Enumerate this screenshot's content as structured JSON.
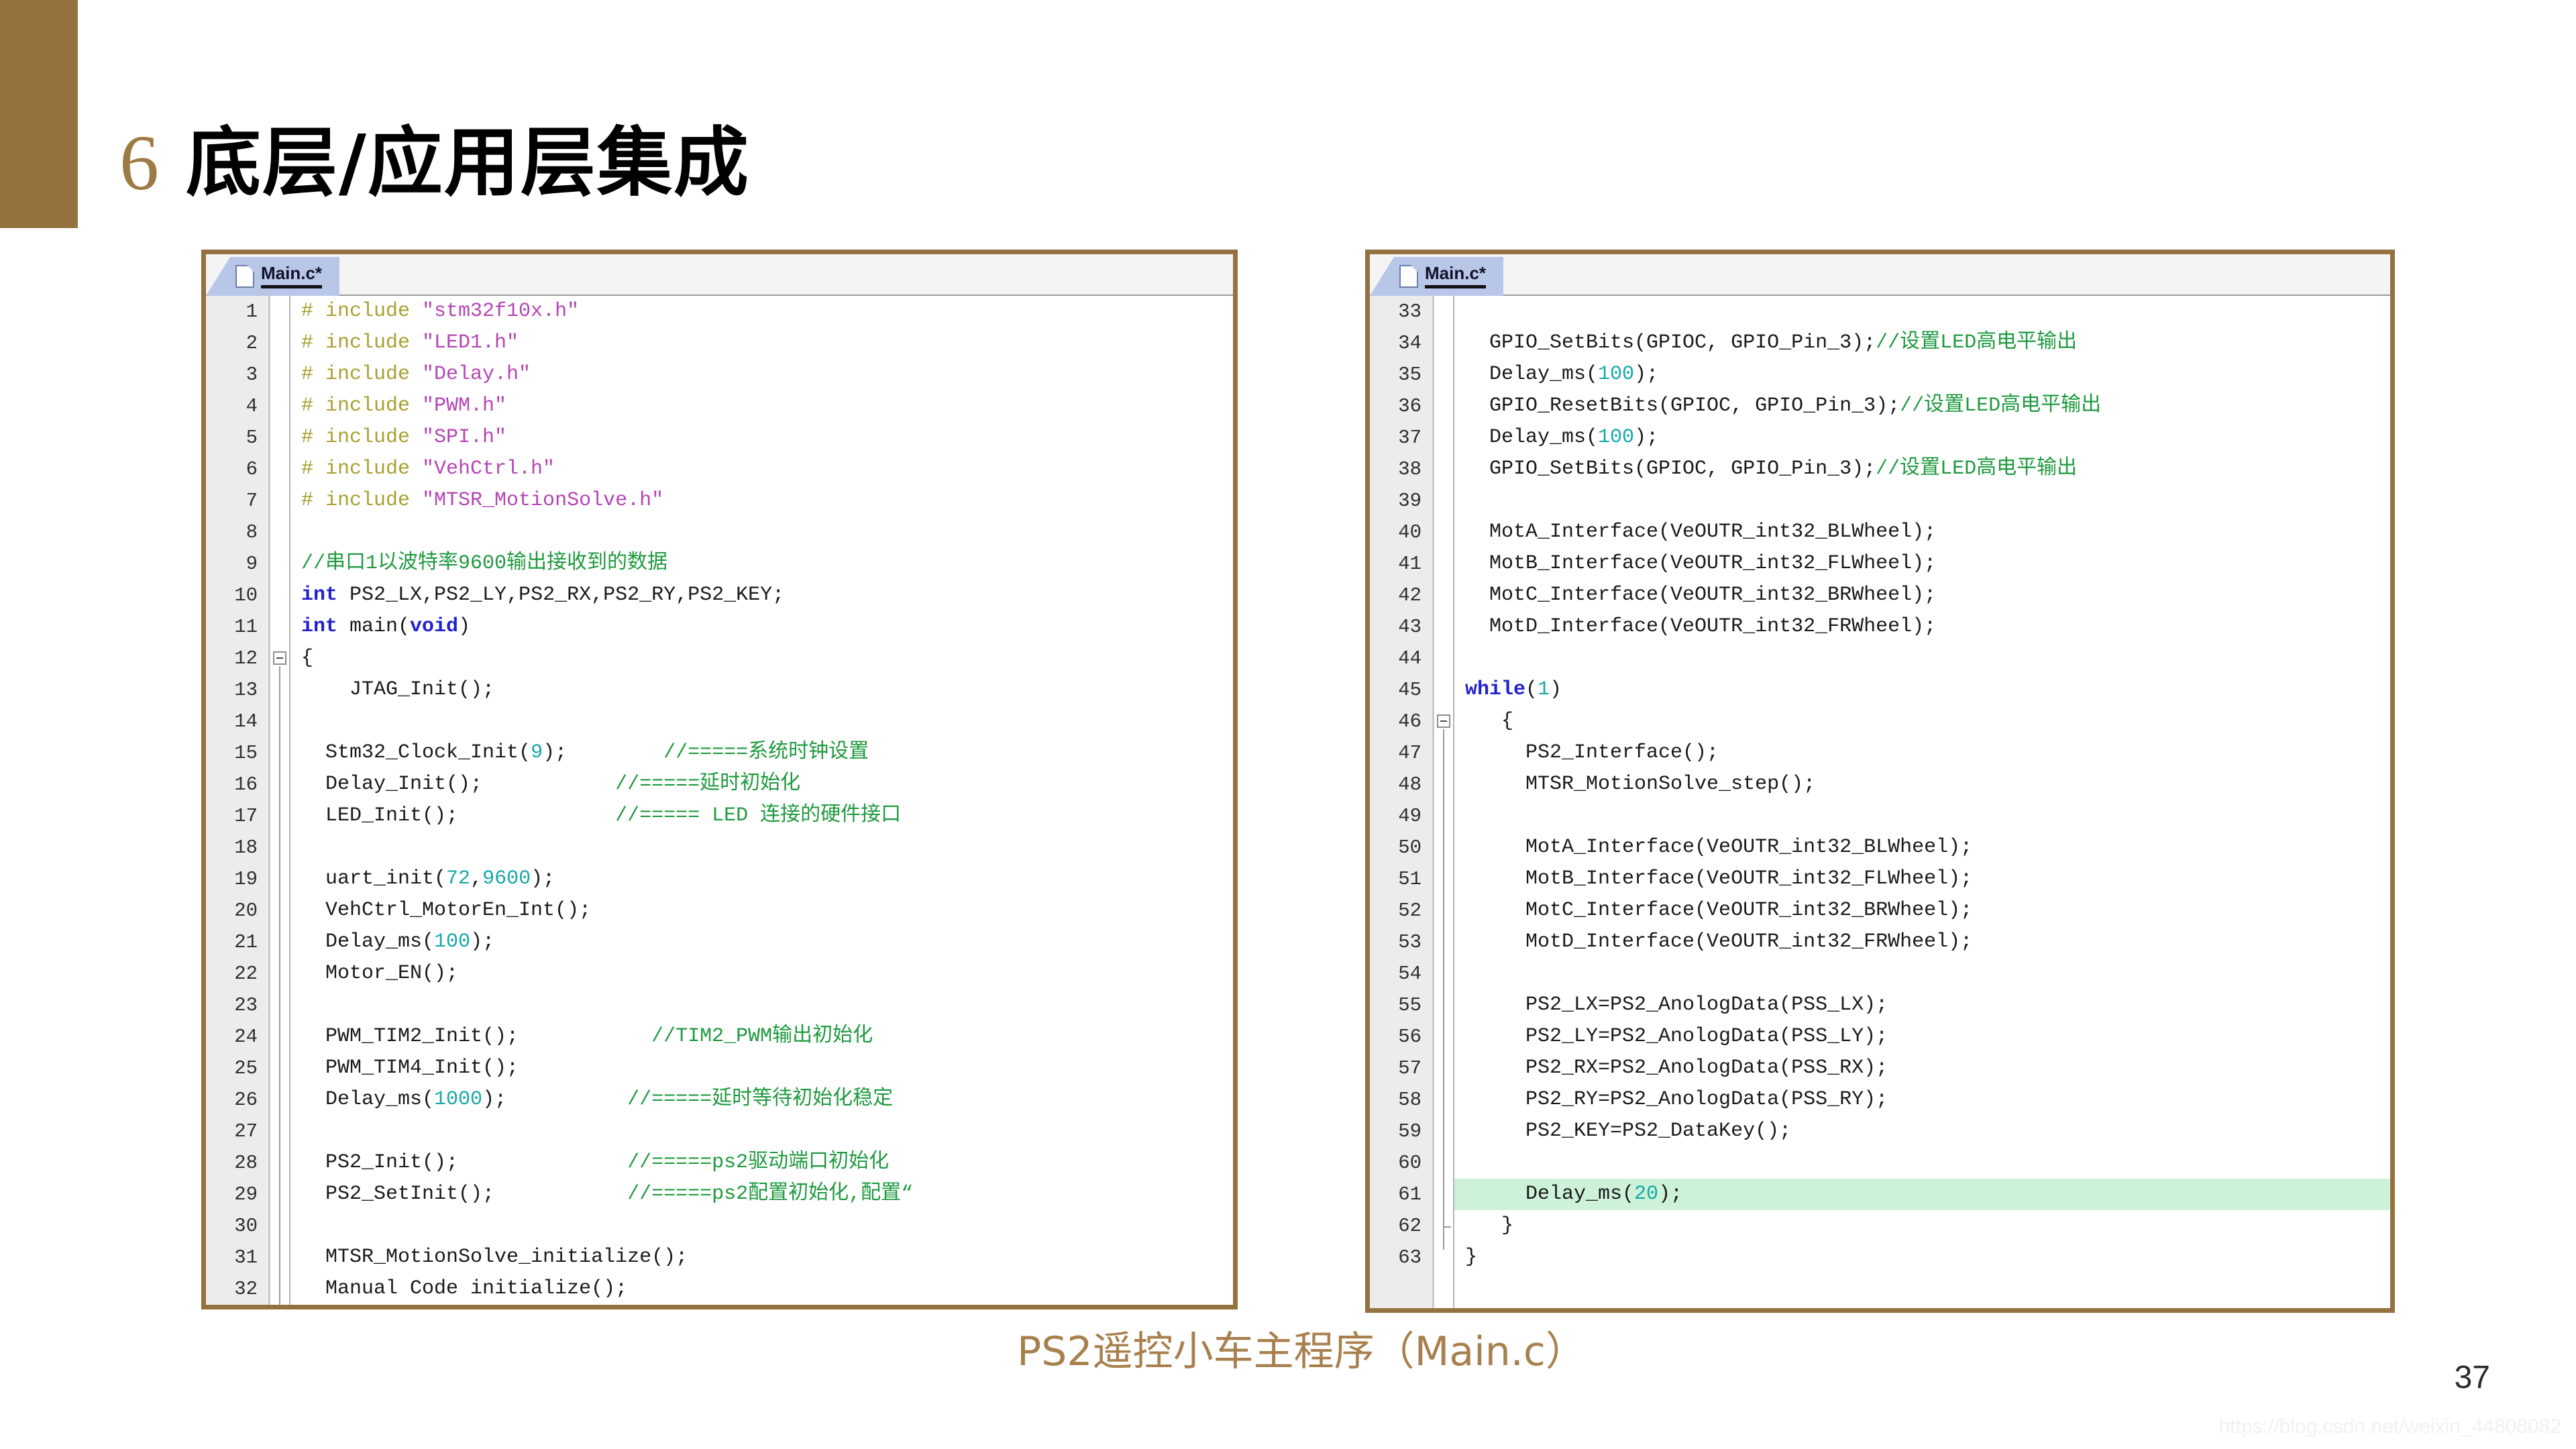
{
  "slide": {
    "title_number": "6",
    "title_text": "底层/应用层集成",
    "caption": "PS2遥控小车主程序（Main.c）",
    "page_number": "37",
    "watermark": "https://blog.csdn.net/weixin_44808082",
    "accent_color": "#94723f",
    "caption_color": "#a8804e",
    "highlight_color": "#cdf2d8"
  },
  "panels": [
    {
      "id": "left",
      "tab_label": "Main.c*",
      "tab_icon": "file-icon",
      "first_line": 1,
      "lines": [
        {
          "n": 1,
          "tokens": [
            {
              "t": "pre",
              "v": "# include "
            },
            {
              "t": "str",
              "v": "\"stm32f10x.h\""
            }
          ]
        },
        {
          "n": 2,
          "tokens": [
            {
              "t": "pre",
              "v": "# include "
            },
            {
              "t": "str",
              "v": "\"LED1.h\""
            }
          ]
        },
        {
          "n": 3,
          "tokens": [
            {
              "t": "pre",
              "v": "# include "
            },
            {
              "t": "str",
              "v": "\"Delay.h\""
            }
          ]
        },
        {
          "n": 4,
          "tokens": [
            {
              "t": "pre",
              "v": "# include "
            },
            {
              "t": "str",
              "v": "\"PWM.h\""
            }
          ]
        },
        {
          "n": 5,
          "tokens": [
            {
              "t": "pre",
              "v": "# include "
            },
            {
              "t": "str",
              "v": "\"SPI.h\""
            }
          ]
        },
        {
          "n": 6,
          "tokens": [
            {
              "t": "pre",
              "v": "# include "
            },
            {
              "t": "str",
              "v": "\"VehCtrl.h\""
            }
          ]
        },
        {
          "n": 7,
          "tokens": [
            {
              "t": "pre",
              "v": "# include "
            },
            {
              "t": "str",
              "v": "\"MTSR_MotionSolve.h\""
            }
          ]
        },
        {
          "n": 8,
          "tokens": []
        },
        {
          "n": 9,
          "tokens": [
            {
              "t": "com",
              "v": "//串口1以波特率9600输出接收到的数据"
            }
          ]
        },
        {
          "n": 10,
          "tokens": [
            {
              "t": "kw",
              "v": "int"
            },
            {
              "t": "plain",
              "v": " PS2_LX,PS2_LY,PS2_RX,PS2_RY,PS2_KEY;"
            }
          ]
        },
        {
          "n": 11,
          "tokens": [
            {
              "t": "kw",
              "v": "int"
            },
            {
              "t": "plain",
              "v": " main("
            },
            {
              "t": "kw",
              "v": "void"
            },
            {
              "t": "plain",
              "v": ")"
            }
          ]
        },
        {
          "n": 12,
          "tokens": [
            {
              "t": "plain",
              "v": "{"
            }
          ],
          "fold": "start"
        },
        {
          "n": 13,
          "tokens": [
            {
              "t": "plain",
              "v": "    JTAG_Init();"
            }
          ]
        },
        {
          "n": 14,
          "tokens": []
        },
        {
          "n": 15,
          "tokens": [
            {
              "t": "plain",
              "v": "  Stm32_Clock_Init("
            },
            {
              "t": "num",
              "v": "9"
            },
            {
              "t": "plain",
              "v": ");"
            },
            {
              "t": "plain",
              "v": "        "
            },
            {
              "t": "com",
              "v": "//=====系统时钟设置"
            }
          ]
        },
        {
          "n": 16,
          "tokens": [
            {
              "t": "plain",
              "v": "  Delay_Init();"
            },
            {
              "t": "plain",
              "v": "           "
            },
            {
              "t": "com",
              "v": "//=====延时初始化"
            }
          ]
        },
        {
          "n": 17,
          "tokens": [
            {
              "t": "plain",
              "v": "  LED_Init();"
            },
            {
              "t": "plain",
              "v": "             "
            },
            {
              "t": "com",
              "v": "//===== LED 连接的硬件接口"
            }
          ]
        },
        {
          "n": 18,
          "tokens": []
        },
        {
          "n": 19,
          "tokens": [
            {
              "t": "plain",
              "v": "  uart_init("
            },
            {
              "t": "num",
              "v": "72"
            },
            {
              "t": "plain",
              "v": ","
            },
            {
              "t": "num",
              "v": "9600"
            },
            {
              "t": "plain",
              "v": ");"
            }
          ]
        },
        {
          "n": 20,
          "tokens": [
            {
              "t": "plain",
              "v": "  VehCtrl_MotorEn_Int();"
            }
          ]
        },
        {
          "n": 21,
          "tokens": [
            {
              "t": "plain",
              "v": "  Delay_ms("
            },
            {
              "t": "num",
              "v": "100"
            },
            {
              "t": "plain",
              "v": ");"
            }
          ]
        },
        {
          "n": 22,
          "tokens": [
            {
              "t": "plain",
              "v": "  Motor_EN();"
            }
          ]
        },
        {
          "n": 23,
          "tokens": []
        },
        {
          "n": 24,
          "tokens": [
            {
              "t": "plain",
              "v": "  PWM_TIM2_Init();"
            },
            {
              "t": "plain",
              "v": "           "
            },
            {
              "t": "com",
              "v": "//TIM2_PWM输出初始化"
            }
          ]
        },
        {
          "n": 25,
          "tokens": [
            {
              "t": "plain",
              "v": "  PWM_TIM4_Init();"
            }
          ]
        },
        {
          "n": 26,
          "tokens": [
            {
              "t": "plain",
              "v": "  Delay_ms("
            },
            {
              "t": "num",
              "v": "1000"
            },
            {
              "t": "plain",
              "v": ");"
            },
            {
              "t": "plain",
              "v": "          "
            },
            {
              "t": "com",
              "v": "//=====延时等待初始化稳定"
            }
          ]
        },
        {
          "n": 27,
          "tokens": []
        },
        {
          "n": 28,
          "tokens": [
            {
              "t": "plain",
              "v": "  PS2_Init();"
            },
            {
              "t": "plain",
              "v": "              "
            },
            {
              "t": "com",
              "v": "//=====ps2驱动端口初始化"
            }
          ]
        },
        {
          "n": 29,
          "tokens": [
            {
              "t": "plain",
              "v": "  PS2_SetInit();"
            },
            {
              "t": "plain",
              "v": "           "
            },
            {
              "t": "com",
              "v": "//=====ps2配置初始化,配置“"
            }
          ]
        },
        {
          "n": 30,
          "tokens": []
        },
        {
          "n": 31,
          "tokens": [
            {
              "t": "plain",
              "v": "  MTSR_MotionSolve_initialize();"
            }
          ]
        },
        {
          "n": 32,
          "tokens": [
            {
              "t": "plain",
              "v": "  Manual Code initialize();"
            }
          ]
        }
      ]
    },
    {
      "id": "right",
      "tab_label": "Main.c*",
      "tab_icon": "file-icon",
      "first_line": 33,
      "lines": [
        {
          "n": 33,
          "tokens": []
        },
        {
          "n": 34,
          "tokens": [
            {
              "t": "plain",
              "v": "  GPIO_SetBits(GPIOC, GPIO_Pin_3);"
            },
            {
              "t": "com",
              "v": "//设置LED高电平输出"
            }
          ]
        },
        {
          "n": 35,
          "tokens": [
            {
              "t": "plain",
              "v": "  Delay_ms("
            },
            {
              "t": "num",
              "v": "100"
            },
            {
              "t": "plain",
              "v": ");"
            }
          ]
        },
        {
          "n": 36,
          "tokens": [
            {
              "t": "plain",
              "v": "  GPIO_ResetBits(GPIOC, GPIO_Pin_3);"
            },
            {
              "t": "com",
              "v": "//设置LED高电平输出"
            }
          ]
        },
        {
          "n": 37,
          "tokens": [
            {
              "t": "plain",
              "v": "  Delay_ms("
            },
            {
              "t": "num",
              "v": "100"
            },
            {
              "t": "plain",
              "v": ");"
            }
          ]
        },
        {
          "n": 38,
          "tokens": [
            {
              "t": "plain",
              "v": "  GPIO_SetBits(GPIOC, GPIO_Pin_3);"
            },
            {
              "t": "com",
              "v": "//设置LED高电平输出"
            }
          ]
        },
        {
          "n": 39,
          "tokens": []
        },
        {
          "n": 40,
          "tokens": [
            {
              "t": "plain",
              "v": "  MotA_Interface(VeOUTR_int32_BLWheel);"
            }
          ]
        },
        {
          "n": 41,
          "tokens": [
            {
              "t": "plain",
              "v": "  MotB_Interface(VeOUTR_int32_FLWheel);"
            }
          ]
        },
        {
          "n": 42,
          "tokens": [
            {
              "t": "plain",
              "v": "  MotC_Interface(VeOUTR_int32_BRWheel);"
            }
          ]
        },
        {
          "n": 43,
          "tokens": [
            {
              "t": "plain",
              "v": "  MotD_Interface(VeOUTR_int32_FRWheel);"
            }
          ]
        },
        {
          "n": 44,
          "tokens": []
        },
        {
          "n": 45,
          "tokens": [
            {
              "t": "kw",
              "v": "while"
            },
            {
              "t": "plain",
              "v": "("
            },
            {
              "t": "num",
              "v": "1"
            },
            {
              "t": "plain",
              "v": ")"
            }
          ],
          "indent": 1
        },
        {
          "n": 46,
          "tokens": [
            {
              "t": "plain",
              "v": "   {"
            }
          ],
          "fold": "start"
        },
        {
          "n": 47,
          "tokens": [
            {
              "t": "plain",
              "v": "     PS2_Interface();"
            }
          ]
        },
        {
          "n": 48,
          "tokens": [
            {
              "t": "plain",
              "v": "     MTSR_MotionSolve_step();"
            }
          ]
        },
        {
          "n": 49,
          "tokens": []
        },
        {
          "n": 50,
          "tokens": [
            {
              "t": "plain",
              "v": "     MotA_Interface(VeOUTR_int32_BLWheel);"
            }
          ]
        },
        {
          "n": 51,
          "tokens": [
            {
              "t": "plain",
              "v": "     MotB_Interface(VeOUTR_int32_FLWheel);"
            }
          ]
        },
        {
          "n": 52,
          "tokens": [
            {
              "t": "plain",
              "v": "     MotC_Interface(VeOUTR_int32_BRWheel);"
            }
          ]
        },
        {
          "n": 53,
          "tokens": [
            {
              "t": "plain",
              "v": "     MotD_Interface(VeOUTR_int32_FRWheel);"
            }
          ]
        },
        {
          "n": 54,
          "tokens": []
        },
        {
          "n": 55,
          "tokens": [
            {
              "t": "plain",
              "v": "     PS2_LX=PS2_AnologData(PSS_LX);"
            }
          ]
        },
        {
          "n": 56,
          "tokens": [
            {
              "t": "plain",
              "v": "     PS2_LY=PS2_AnologData(PSS_LY);"
            }
          ]
        },
        {
          "n": 57,
          "tokens": [
            {
              "t": "plain",
              "v": "     PS2_RX=PS2_AnologData(PSS_RX);"
            }
          ]
        },
        {
          "n": 58,
          "tokens": [
            {
              "t": "plain",
              "v": "     PS2_RY=PS2_AnologData(PSS_RY);"
            }
          ]
        },
        {
          "n": 59,
          "tokens": [
            {
              "t": "plain",
              "v": "     PS2_KEY=PS2_DataKey();"
            }
          ]
        },
        {
          "n": 60,
          "tokens": []
        },
        {
          "n": 61,
          "tokens": [
            {
              "t": "plain",
              "v": "     Delay_ms("
            },
            {
              "t": "num",
              "v": "20"
            },
            {
              "t": "plain",
              "v": ");"
            }
          ],
          "highlight": true
        },
        {
          "n": 62,
          "tokens": [
            {
              "t": "plain",
              "v": "   }"
            }
          ],
          "fold": "end"
        },
        {
          "n": 63,
          "tokens": [
            {
              "t": "plain",
              "v": "}"
            }
          ]
        }
      ]
    }
  ]
}
